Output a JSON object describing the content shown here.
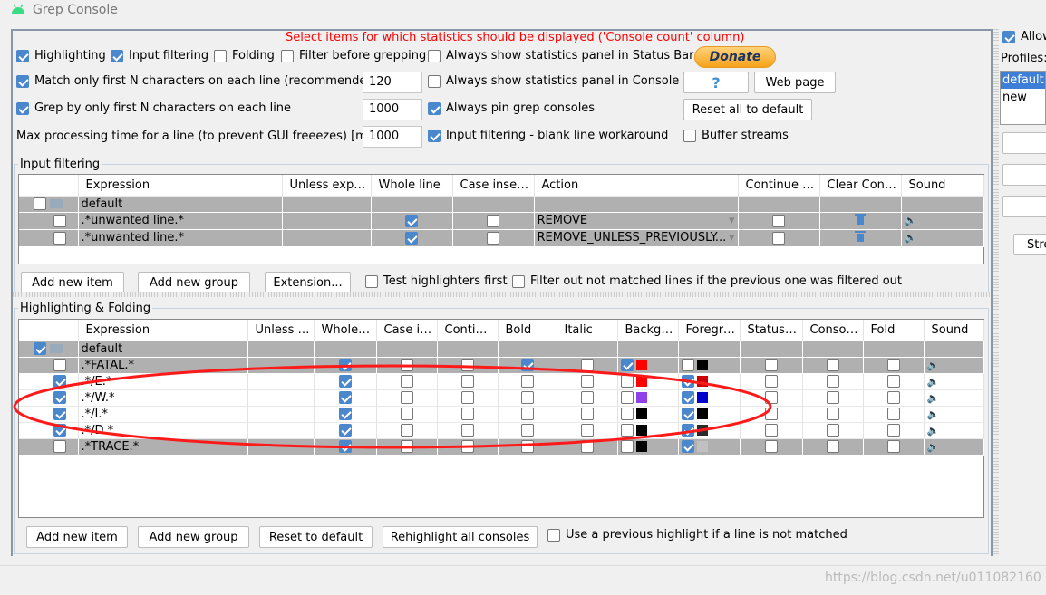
{
  "window": {
    "title": "Grep Console"
  },
  "notice": "Select items for which statistics should be displayed ('Console count' column)",
  "options": {
    "highlighting": {
      "label": "Highlighting",
      "checked": true
    },
    "input_filtering": {
      "label": "Input filtering",
      "checked": true
    },
    "folding": {
      "label": "Folding",
      "checked": false
    },
    "filter_before": {
      "label": "Filter before grepping",
      "checked": false
    },
    "stats_status_bar": {
      "label": "Always show statistics panel in Status Bar",
      "checked": false
    },
    "match_first_n": {
      "label": "Match only first N characters on each line (recommended)",
      "checked": true,
      "value": "120"
    },
    "stats_console": {
      "label": "Always show statistics panel in Console",
      "checked": false
    },
    "grep_first_n": {
      "label": "Grep by only first N characters on each line",
      "checked": true,
      "value": "1000"
    },
    "pin_consoles": {
      "label": "Always pin grep consoles",
      "checked": true
    },
    "max_time": {
      "label": "Max processing time for a line (to prevent GUI freeezes) [ms]",
      "value": "1000"
    },
    "blank_line": {
      "label": "Input filtering - blank line workaround",
      "checked": true
    },
    "buffer_streams": {
      "label": "Buffer streams",
      "checked": false
    }
  },
  "buttons": {
    "donate": "Donate",
    "help": "?",
    "web_page": "Web page",
    "reset_all": "Reset all to default"
  },
  "input_filtering": {
    "title": "Input filtering",
    "columns": [
      "",
      "Expression",
      "Unless expre...",
      "Whole line",
      "Case insens...",
      "Action",
      "Continue m...",
      "Clear Cons...",
      "Sound"
    ],
    "group": "default",
    "rows": [
      {
        "enabled": false,
        "expression": ".*unwanted line.*",
        "whole_line": true,
        "case_insensitive": false,
        "action": "REMOVE",
        "continue": false
      },
      {
        "enabled": false,
        "expression": ".*unwanted line.*",
        "whole_line": true,
        "case_insensitive": false,
        "action": "REMOVE_UNLESS_PREVIOUSLY...",
        "continue": false
      }
    ],
    "buttons": {
      "add_item": "Add new item",
      "add_group": "Add new group",
      "extension": "Extension..."
    },
    "test_highlighters": {
      "label": "Test highlighters first",
      "checked": false
    },
    "filter_out": {
      "label": "Filter out not matched lines if the previous one was filtered out",
      "checked": false
    }
  },
  "highlighting": {
    "title": "Highlighting & Folding",
    "columns": [
      "",
      "Expression",
      "Unless ex...",
      "Whole li...",
      "Case ins...",
      "Continu...",
      "Bold",
      "Italic",
      "Backgro...",
      "Foregro...",
      "StatusB...",
      "Console...",
      "Fold",
      "Sound"
    ],
    "group": "default",
    "rows": [
      {
        "enabled": false,
        "expression": ".*FATAL.*",
        "whole": true,
        "bold": true,
        "bg_on": true,
        "bg": "#ff0000",
        "fg_on": false,
        "fg": "#000000",
        "grey": true
      },
      {
        "enabled": true,
        "expression": ".*/E.*",
        "whole": true,
        "bold": false,
        "bg_on": false,
        "bg": "#ff0000",
        "fg_on": true,
        "fg": "#cc0000",
        "grey": false
      },
      {
        "enabled": true,
        "expression": ".*/W.*",
        "whole": true,
        "bold": false,
        "bg_on": false,
        "bg": "#9040e8",
        "fg_on": true,
        "fg": "#0000cc",
        "grey": false
      },
      {
        "enabled": true,
        "expression": ".*/I.*",
        "whole": true,
        "bold": false,
        "bg_on": false,
        "bg": "#000000",
        "fg_on": true,
        "fg": "#000000",
        "grey": false
      },
      {
        "enabled": true,
        "expression": ".*/D.*",
        "whole": true,
        "bold": false,
        "bg_on": false,
        "bg": "#000000",
        "fg_on": true,
        "fg": "#2b2b2b",
        "grey": false
      },
      {
        "enabled": false,
        "expression": ".*TRACE.*",
        "whole": true,
        "bold": false,
        "bg_on": false,
        "bg": "#000000",
        "fg_on": true,
        "fg": "#c0c0c0",
        "grey": true
      }
    ],
    "buttons": {
      "add_item": "Add new item",
      "add_group": "Add new group",
      "reset": "Reset to default",
      "rehighlight": "Rehighlight all consoles"
    },
    "use_previous": {
      "label": "Use a previous highlight if a line is not matched",
      "checked": false
    }
  },
  "profiles": {
    "allow_label": "Allow",
    "allow_checked": true,
    "label": "Profiles:",
    "items": [
      "default",
      "new"
    ],
    "selected": "default",
    "button": "Stre"
  },
  "watermark": "https://blog.csdn.net/u011082160",
  "colors": {
    "notice": "#ff0000",
    "selection": "#3d7fd6",
    "annotation": "#ff0000"
  }
}
